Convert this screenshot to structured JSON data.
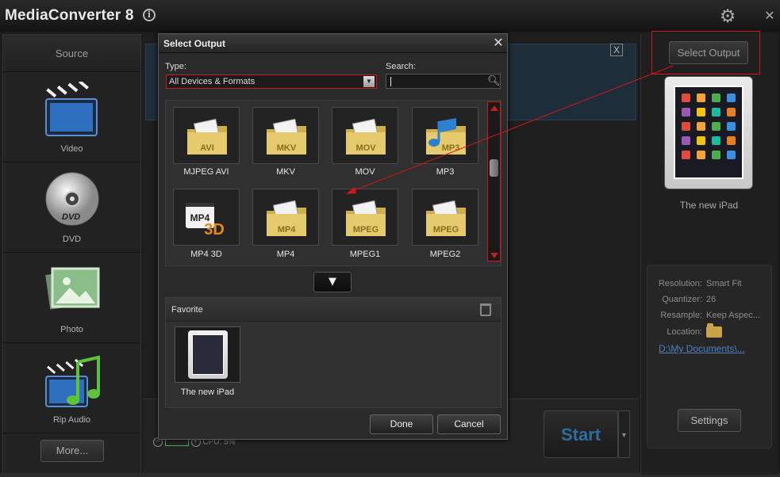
{
  "app": {
    "title": "MediaConverter 8",
    "info_icon": "i"
  },
  "sidebar": {
    "header": "Source",
    "items": [
      {
        "label": "Video",
        "icon": "clapperboard-icon"
      },
      {
        "label": "DVD",
        "icon": "dvd-disc-icon"
      },
      {
        "label": "Photo",
        "icon": "photo-icon"
      },
      {
        "label": "Rip Audio",
        "icon": "music-clapperboard-icon"
      }
    ],
    "more_label": "More..."
  },
  "main": {
    "close_symbol": "X",
    "cpu_text": "CPU: 5%",
    "start_label": "Start"
  },
  "right": {
    "select_output_label": "Select Output",
    "device_name": "The new iPad",
    "properties": [
      {
        "key": "Resolution:",
        "value": "Smart Fit"
      },
      {
        "key": "Quantizer:",
        "value": "26"
      },
      {
        "key": "Resample:",
        "value": "Keep Aspec..."
      },
      {
        "key": "Location:",
        "value": ""
      }
    ],
    "location_link": "D:\\My Documents\\...",
    "settings_label": "Settings"
  },
  "dialog": {
    "title": "Select Output",
    "type_label": "Type:",
    "type_value": "All Devices & Formats",
    "search_label": "Search:",
    "search_value": "",
    "formats": [
      {
        "label": "MJPEG AVI",
        "badge": "AVI"
      },
      {
        "label": "MKV",
        "badge": "MKV"
      },
      {
        "label": "MOV",
        "badge": "MOV"
      },
      {
        "label": "MP3",
        "badge": "MP3"
      },
      {
        "label": "MP4 3D",
        "badge": "MP4"
      },
      {
        "label": "MP4",
        "badge": "MP4"
      },
      {
        "label": "MPEG1",
        "badge": "MPEG"
      },
      {
        "label": "MPEG2",
        "badge": "MPEG"
      }
    ],
    "favorite_title": "Favorite",
    "favorites": [
      {
        "label": "The new iPad"
      }
    ],
    "done_label": "Done",
    "cancel_label": "Cancel"
  },
  "colors": {
    "annotation_red": "#d01818",
    "accent_blue": "#2f6e9c",
    "folder_yellow": "#e3c565"
  }
}
